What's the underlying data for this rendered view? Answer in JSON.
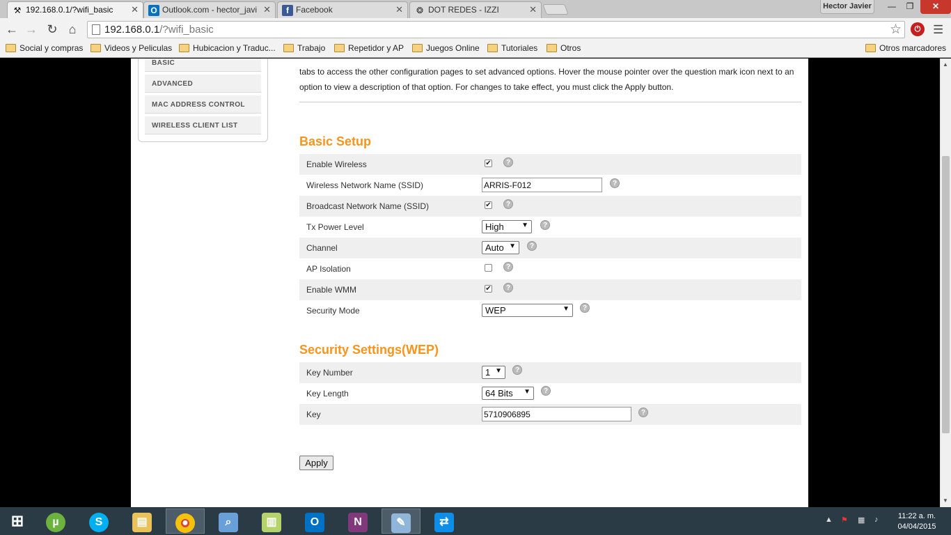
{
  "browser": {
    "tabs": [
      {
        "title": "192.168.0.1/?wifi_basic",
        "active": true,
        "icon": "tools-icon"
      },
      {
        "title": "Outlook.com - hector_javi",
        "active": false,
        "icon": "outlook-icon"
      },
      {
        "title": "Facebook",
        "active": false,
        "icon": "facebook-icon"
      },
      {
        "title": "DOT REDES - IZZI",
        "active": false,
        "icon": "dot-redes-icon"
      }
    ],
    "user": "Hector Javier",
    "url_host": "192.168.0.1",
    "url_path": "/?wifi_basic",
    "bookmarks": [
      "Social y compras",
      "Videos y Peliculas",
      "Hubicacion y Traduc...",
      "Trabajo",
      "Repetidor y AP",
      "Juegos Online",
      "Tutoriales",
      "Otros"
    ],
    "other_bookmarks": "Otros marcadores"
  },
  "sidebar": {
    "items": [
      "BASIC",
      "ADVANCED",
      "MAC ADDRESS CONTROL",
      "WIRELESS CLIENT LIST"
    ]
  },
  "intro": {
    "line1": "tabs to access the other configuration pages to set advanced options. Hover the mouse pointer over the question mark icon next to an",
    "line2": "option to view a description of that option. For changes to take effect, you must click the Apply button."
  },
  "basic_setup": {
    "title": "Basic Setup",
    "enable_wireless": {
      "label": "Enable Wireless",
      "checked": true
    },
    "ssid": {
      "label": "Wireless Network Name (SSID)",
      "value": "ARRIS-F012"
    },
    "broadcast": {
      "label": "Broadcast Network Name (SSID)",
      "checked": true
    },
    "tx_power": {
      "label": "Tx Power Level",
      "value": "High"
    },
    "channel": {
      "label": "Channel",
      "value": "Auto"
    },
    "ap_isolation": {
      "label": "AP Isolation",
      "checked": false
    },
    "wmm": {
      "label": "Enable WMM",
      "checked": true
    },
    "security_mode": {
      "label": "Security Mode",
      "value": "WEP"
    }
  },
  "security_settings": {
    "title": "Security Settings(WEP)",
    "key_number": {
      "label": "Key Number",
      "value": "1"
    },
    "key_length": {
      "label": "Key Length",
      "value": "64 Bits"
    },
    "key": {
      "label": "Key",
      "value": "5710906895"
    }
  },
  "apply_label": "Apply",
  "help_glyph": "?",
  "clock": {
    "time": "11:22 a. m.",
    "date": "04/04/2015"
  },
  "colors": {
    "accent": "#f7941d",
    "row_shade": "#efefef"
  }
}
